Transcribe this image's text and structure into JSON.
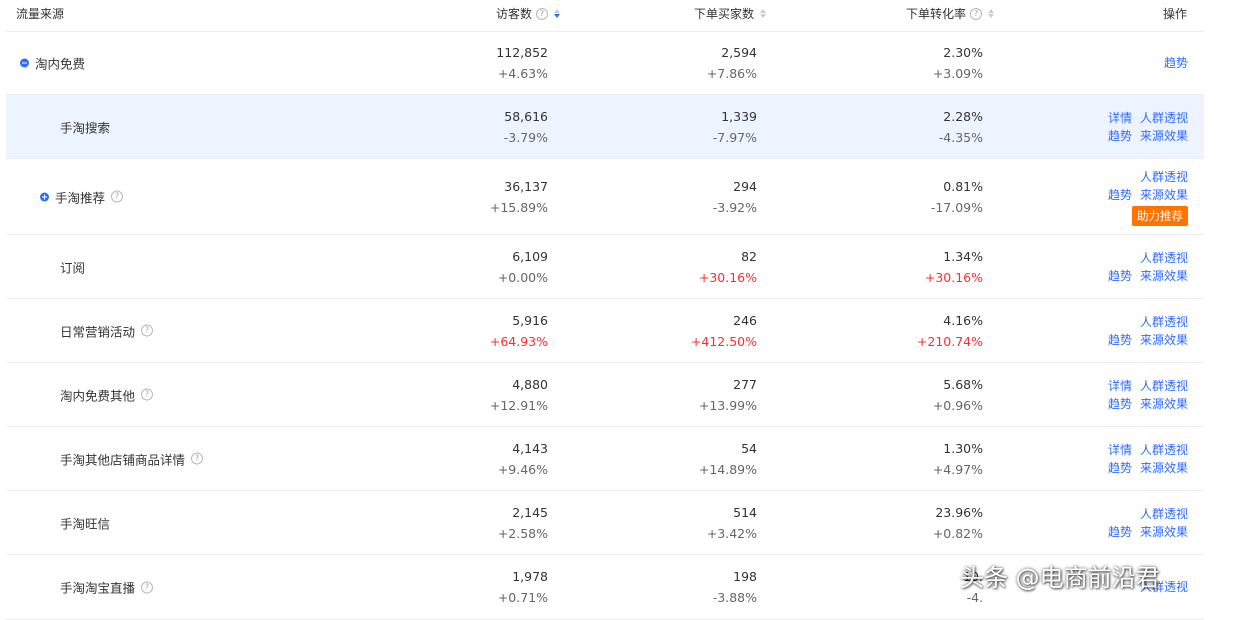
{
  "header": {
    "source": "流量来源",
    "visitors": "访客数",
    "buyers": "下单买家数",
    "conversion": "下单转化率",
    "actions": "操作"
  },
  "rows": [
    {
      "name": "淘内免费",
      "expand": "minus",
      "help": false,
      "highlight": false,
      "visitors": "112,852",
      "visitors_delta": "+4.63%",
      "visitors_red": false,
      "buyers": "2,594",
      "buyers_delta": "+7.86%",
      "buyers_red": false,
      "conv": "2.30%",
      "conv_delta": "+3.09%",
      "conv_red": false,
      "ops_line1": [],
      "ops_line2": [
        "趋势"
      ],
      "badge": ""
    },
    {
      "name": "手淘搜索",
      "expand": "",
      "help": false,
      "highlight": true,
      "visitors": "58,616",
      "visitors_delta": "-3.79%",
      "visitors_red": false,
      "buyers": "1,339",
      "buyers_delta": "-7.97%",
      "buyers_red": false,
      "conv": "2.28%",
      "conv_delta": "-4.35%",
      "conv_red": false,
      "ops_line1": [
        "详情",
        "人群透视"
      ],
      "ops_line2": [
        "趋势",
        "来源效果"
      ],
      "badge": ""
    },
    {
      "name": "手淘推荐",
      "expand": "plus",
      "help": true,
      "highlight": false,
      "visitors": "36,137",
      "visitors_delta": "+15.89%",
      "visitors_red": false,
      "buyers": "294",
      "buyers_delta": "-3.92%",
      "buyers_red": false,
      "conv": "0.81%",
      "conv_delta": "-17.09%",
      "conv_red": false,
      "ops_line1": [
        "人群透视"
      ],
      "ops_line2": [
        "趋势",
        "来源效果"
      ],
      "badge": "助力推荐"
    },
    {
      "name": "订阅",
      "expand": "",
      "help": false,
      "highlight": false,
      "visitors": "6,109",
      "visitors_delta": "+0.00%",
      "visitors_red": false,
      "buyers": "82",
      "buyers_delta": "+30.16%",
      "buyers_red": true,
      "conv": "1.34%",
      "conv_delta": "+30.16%",
      "conv_red": true,
      "ops_line1": [
        "人群透视"
      ],
      "ops_line2": [
        "趋势",
        "来源效果"
      ],
      "badge": ""
    },
    {
      "name": "日常营销活动",
      "expand": "",
      "help": true,
      "highlight": false,
      "visitors": "5,916",
      "visitors_delta": "+64.93%",
      "visitors_red": true,
      "buyers": "246",
      "buyers_delta": "+412.50%",
      "buyers_red": true,
      "conv": "4.16%",
      "conv_delta": "+210.74%",
      "conv_red": true,
      "ops_line1": [
        "人群透视"
      ],
      "ops_line2": [
        "趋势",
        "来源效果"
      ],
      "badge": ""
    },
    {
      "name": "淘内免费其他",
      "expand": "",
      "help": true,
      "highlight": false,
      "visitors": "4,880",
      "visitors_delta": "+12.91%",
      "visitors_red": false,
      "buyers": "277",
      "buyers_delta": "+13.99%",
      "buyers_red": false,
      "conv": "5.68%",
      "conv_delta": "+0.96%",
      "conv_red": false,
      "ops_line1": [
        "详情",
        "人群透视"
      ],
      "ops_line2": [
        "趋势",
        "来源效果"
      ],
      "badge": ""
    },
    {
      "name": "手淘其他店铺商品详情",
      "expand": "",
      "help": true,
      "highlight": false,
      "visitors": "4,143",
      "visitors_delta": "+9.46%",
      "visitors_red": false,
      "buyers": "54",
      "buyers_delta": "+14.89%",
      "buyers_red": false,
      "conv": "1.30%",
      "conv_delta": "+4.97%",
      "conv_red": false,
      "ops_line1": [
        "详情",
        "人群透视"
      ],
      "ops_line2": [
        "趋势",
        "来源效果"
      ],
      "badge": ""
    },
    {
      "name": "手淘旺信",
      "expand": "",
      "help": false,
      "highlight": false,
      "visitors": "2,145",
      "visitors_delta": "+2.58%",
      "visitors_red": false,
      "buyers": "514",
      "buyers_delta": "+3.42%",
      "buyers_red": false,
      "conv": "23.96%",
      "conv_delta": "+0.82%",
      "conv_red": false,
      "ops_line1": [
        "人群透视"
      ],
      "ops_line2": [
        "趋势",
        "来源效果"
      ],
      "badge": ""
    },
    {
      "name": "手淘淘宝直播",
      "expand": "",
      "help": true,
      "highlight": false,
      "visitors": "1,978",
      "visitors_delta": "+0.71%",
      "visitors_red": false,
      "buyers": "198",
      "buyers_delta": "-3.88%",
      "buyers_red": false,
      "conv": "10.",
      "conv_delta": "-4.",
      "conv_red": false,
      "ops_line1": [
        "人群透视"
      ],
      "ops_line2": [],
      "badge": ""
    }
  ],
  "watermark": "头条 @电商前沿君"
}
